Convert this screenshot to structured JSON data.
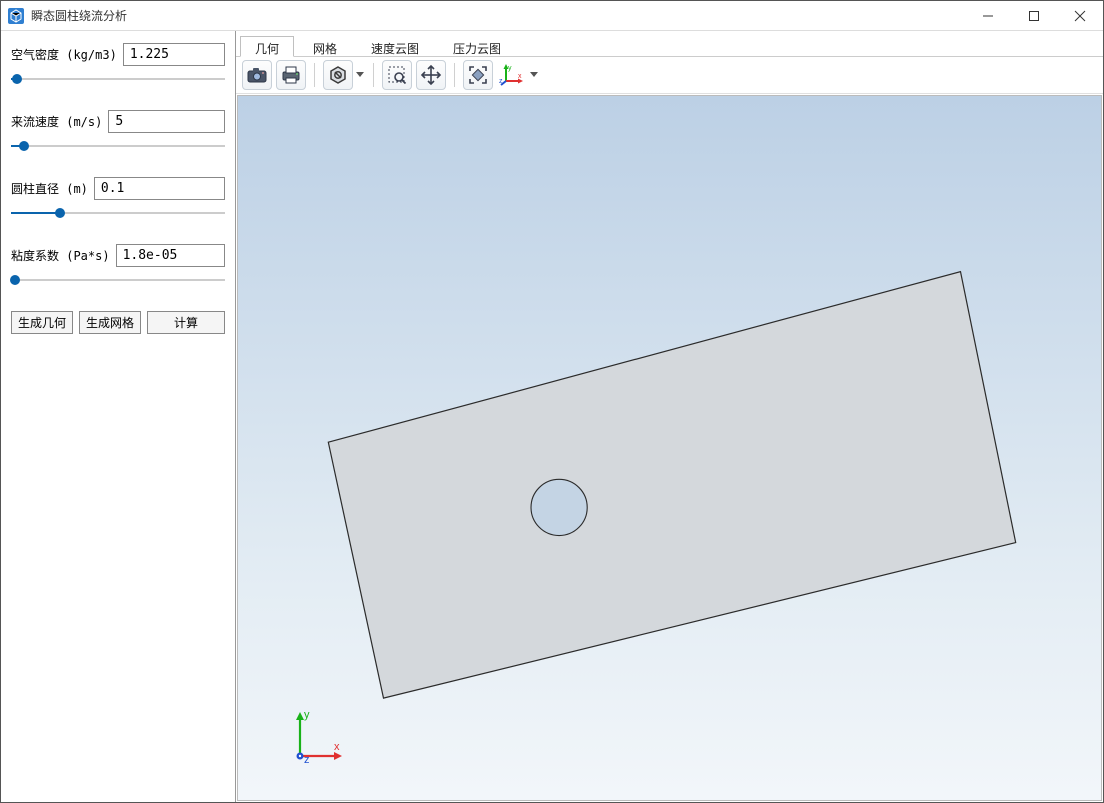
{
  "window": {
    "title": "瞬态圆柱绕流分析"
  },
  "params": {
    "density": {
      "label": "空气密度 (kg/m3)",
      "value": "1.225",
      "pct": 3
    },
    "velocity": {
      "label": "来流速度 (m/s)",
      "value": "5",
      "pct": 6
    },
    "diameter": {
      "label": "圆柱直径 (m)",
      "value": "0.1",
      "pct": 23
    },
    "viscosity": {
      "label": "粘度系数 (Pa*s)",
      "value": "1.8e-05",
      "pct": 2
    }
  },
  "buttons": {
    "gen_geom": "生成几何",
    "gen_mesh": "生成网格",
    "compute": "计算"
  },
  "tabs": {
    "geometry": "几何",
    "mesh": "网格",
    "velocity": "速度云图",
    "pressure": "压力云图"
  },
  "toolbar": {
    "screenshot": "camera-icon",
    "print": "printer-icon",
    "texture": "hex-icon",
    "zoom_area": "zoom-area-icon",
    "pan": "pan-icon",
    "fit": "fit-icon",
    "axes": "axes-icon"
  },
  "triad": {
    "x": "x",
    "y": "y",
    "z": "z"
  }
}
